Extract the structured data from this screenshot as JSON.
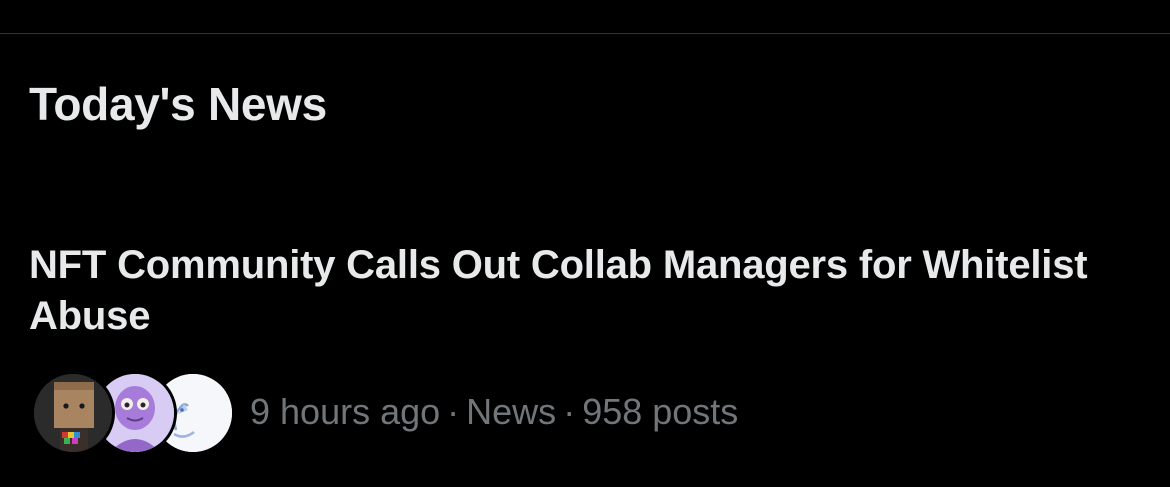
{
  "section": {
    "title": "Today's News"
  },
  "news_item": {
    "headline": "NFT Community Calls Out Collab Managers for Whitelist Abuse",
    "time": "9 hours ago",
    "separator": "·",
    "category": "News",
    "posts": "958 posts",
    "avatars": [
      "avatar-paper-bag-nft",
      "avatar-purple-character-nft",
      "avatar-blue-sketch-nft"
    ]
  },
  "colors": {
    "background": "#000000",
    "primary_text": "#e7e9ea",
    "secondary_text": "#71767b",
    "divider": "#2f3336"
  }
}
